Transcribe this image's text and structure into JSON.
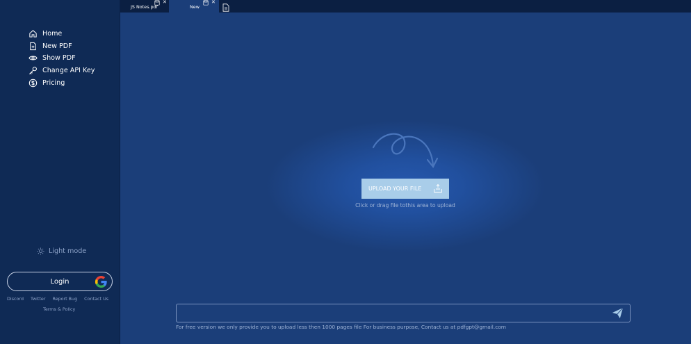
{
  "sidebar": {
    "items": [
      {
        "label": "Home",
        "icon": "home-icon"
      },
      {
        "label": "New PDF",
        "icon": "new-file-icon"
      },
      {
        "label": "Show PDF",
        "icon": "eye-icon"
      },
      {
        "label": "Change API Key",
        "icon": "key-icon"
      },
      {
        "label": "Pricing",
        "icon": "dollar-icon"
      }
    ],
    "light_mode": "Light mode",
    "login": "Login",
    "footer_links": [
      "Discord",
      "Twitter",
      "Report Bug",
      "Contact Us"
    ],
    "terms": "Terms & Policy"
  },
  "tabs": [
    {
      "label": "JS Notes.pdf"
    },
    {
      "label": "New"
    }
  ],
  "upload": {
    "button_label": "UPLOAD YOUR FILE",
    "hint": "Click or drag file tothis area to upload"
  },
  "chat": {
    "input_value": "",
    "disclaimer": "For free version we only provide you to upload less then 1000 pages file For business purpose, Contact us at pdfgpt@gmail.com"
  },
  "colors": {
    "sidebar_bg": "#0f2a55",
    "main_bg": "#1b3e79",
    "upload_button": "#a9cde9",
    "tabbar_bg": "#0b1f42"
  }
}
